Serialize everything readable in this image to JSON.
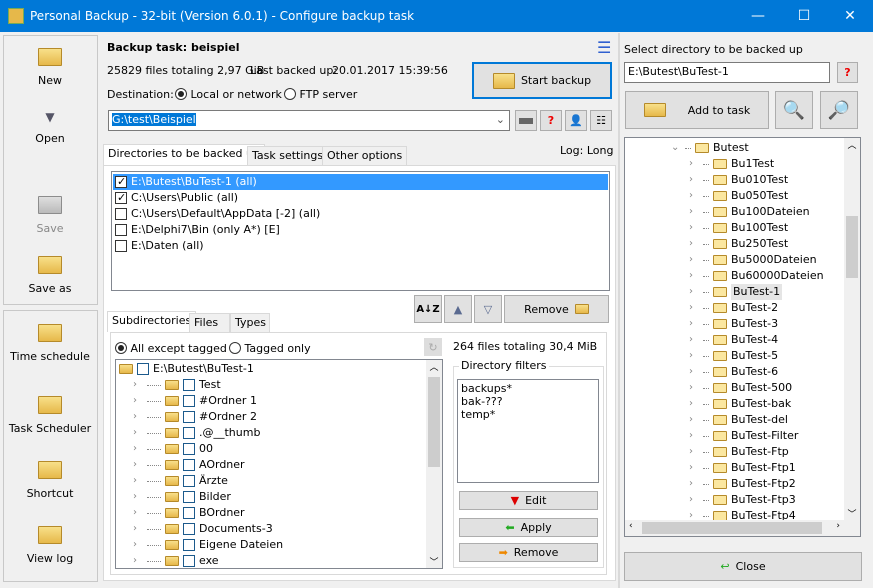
{
  "window": {
    "title": "Personal Backup - 32-bit (Version 6.0.1) - Configure backup task",
    "min": "—",
    "max": "☐",
    "close": "✕"
  },
  "toolbar": [
    {
      "label": "New",
      "icon": "new-folder-icon"
    },
    {
      "label": "Open",
      "icon": "open-icon"
    },
    {
      "label": "Save",
      "icon": "save-icon"
    },
    {
      "label": "Save as",
      "icon": "save-as-icon"
    },
    {
      "label": "Time schedule",
      "icon": "clock-icon"
    },
    {
      "label": "Task Scheduler",
      "icon": "scheduler-clock-icon"
    },
    {
      "label": "Shortcut",
      "icon": "shortcut-icon"
    },
    {
      "label": "View log",
      "icon": "magnifier-log-icon"
    }
  ],
  "task": {
    "title": "Backup task: beispiel",
    "summary": "25829 files totaling 2,97 GiB",
    "last_backup_label": "Last backed up:",
    "last_backup": "20.01.2017 15:39:56",
    "destination_label": "Destination:",
    "dest_local": "Local or network",
    "dest_ftp": "FTP server",
    "dest_path": "G:\\test\\Beispiel",
    "start_backup": "Start backup",
    "log": "Log: Long"
  },
  "tabs": [
    "Directories to be backed up",
    "Task settings",
    "Other options"
  ],
  "directories": [
    {
      "label": "E:\\Butest\\BuTest-1 (all)",
      "checked": true,
      "selected": true
    },
    {
      "label": "C:\\Users\\Public (all)",
      "checked": true
    },
    {
      "label": "C:\\Users\\Default\\AppData [-2] (all)",
      "checked": false
    },
    {
      "label": "E:\\Delphi7\\Bin (only A*) [E]",
      "checked": false
    },
    {
      "label": "E:\\Daten (all)",
      "checked": false
    }
  ],
  "remove_label": "Remove",
  "subtabs": [
    "Subdirectories",
    "Files",
    "Types"
  ],
  "sub": {
    "all_except": "All except tagged",
    "tagged_only": "Tagged only",
    "summary": "264 files totaling 30,4 MiB",
    "root": "E:\\Butest\\BuTest-1",
    "items": [
      "Test",
      "#Ordner 1",
      "#Ordner 2",
      ".@__thumb",
      "00",
      "AOrdner",
      "Ärzte",
      "Bilder",
      "BOrdner",
      "Documents-3",
      "Eigene Dateien",
      "exe"
    ]
  },
  "filters": {
    "title": "Directory filters",
    "items": [
      "backups*",
      "bak-???",
      "temp*"
    ],
    "edit": "Edit",
    "apply": "Apply",
    "remove": "Remove"
  },
  "right": {
    "label": "Select directory to be backed up",
    "path": "E:\\Butest\\BuTest-1",
    "add": "Add to task",
    "root": "Butest",
    "items": [
      "Bu1Test",
      "Bu010Test",
      "Bu050Test",
      "Bu100Dateien",
      "Bu100Test",
      "Bu250Test",
      "Bu5000Dateien",
      "Bu60000Dateien",
      "BuTest-1",
      "BuTest-2",
      "BuTest-3",
      "BuTest-4",
      "BuTest-5",
      "BuTest-6",
      "BuTest-500",
      "BuTest-bak",
      "BuTest-del",
      "BuTest-Filter",
      "BuTest-Ftp",
      "BuTest-Ftp1",
      "BuTest-Ftp2",
      "BuTest-Ftp3",
      "BuTest-Ftp4"
    ],
    "selected": "BuTest-1",
    "close": "Close"
  },
  "help": "?",
  "colors": {
    "accent": "#0078d7",
    "selection": "#3399ff"
  }
}
